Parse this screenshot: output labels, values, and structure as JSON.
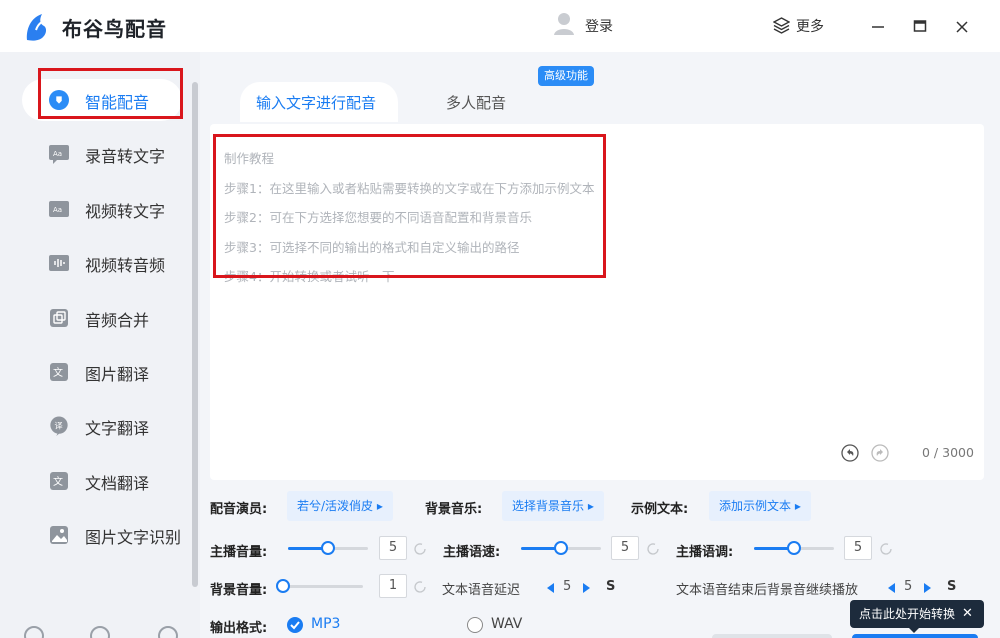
{
  "app": {
    "name": "布谷鸟配音",
    "login": "登录",
    "more": "更多",
    "accent": "#1a7cf2"
  },
  "sidebar": {
    "items": [
      {
        "label": "智能配音",
        "icon": "voice-icon",
        "active": true
      },
      {
        "label": "录音转文字",
        "icon": "audio-to-text-icon"
      },
      {
        "label": "视频转文字",
        "icon": "video-to-text-icon"
      },
      {
        "label": "视频转音频",
        "icon": "video-to-audio-icon"
      },
      {
        "label": "音频合并",
        "icon": "merge-icon"
      },
      {
        "label": "图片翻译",
        "icon": "image-translate-icon"
      },
      {
        "label": "文字翻译",
        "icon": "text-translate-icon"
      },
      {
        "label": "文档翻译",
        "icon": "doc-translate-icon"
      },
      {
        "label": "图片文字识别",
        "icon": "ocr-icon"
      }
    ]
  },
  "tabs": {
    "input": "输入文字进行配音",
    "multi": "多人配音",
    "badge": "高级功能"
  },
  "editor": {
    "guide": [
      "制作教程",
      "步骤1：在这里输入或者粘贴需要转换的文字或在下方添加示例文本",
      "步骤2：可在下方选择您想要的不同语音配置和背景音乐",
      "步骤3：可选择不同的输出的格式和自定义输出的路径",
      "步骤4：开始转换或者试听一下"
    ],
    "count": "0 / 3000"
  },
  "settings": {
    "voice_label": "配音演员:",
    "voice_value": "若兮/活泼俏皮 ▸",
    "bgm_label": "背景音乐:",
    "bgm_value": "选择背景音乐 ▸",
    "sample_label": "示例文本:",
    "sample_value": "添加示例文本 ▸",
    "volume_label": "主播音量:",
    "volume": 5,
    "speed_label": "主播语速:",
    "speed": 5,
    "pitch_label": "主播语调:",
    "pitch": 5,
    "bg_volume_label": "背景音量:",
    "bg_volume": 1,
    "delay_label": "文本语音延迟",
    "delay": 5,
    "delay_unit": "S",
    "continue_label": "文本语音结束后背景音继续播放",
    "continue_value": 5,
    "continue_unit": "S",
    "format_label": "输出格式:",
    "format_mp3": "MP3",
    "format_wav": "WAV",
    "slider_max": 10
  },
  "tooltip": {
    "text": "点击此处开始转换",
    "close": "✕"
  }
}
